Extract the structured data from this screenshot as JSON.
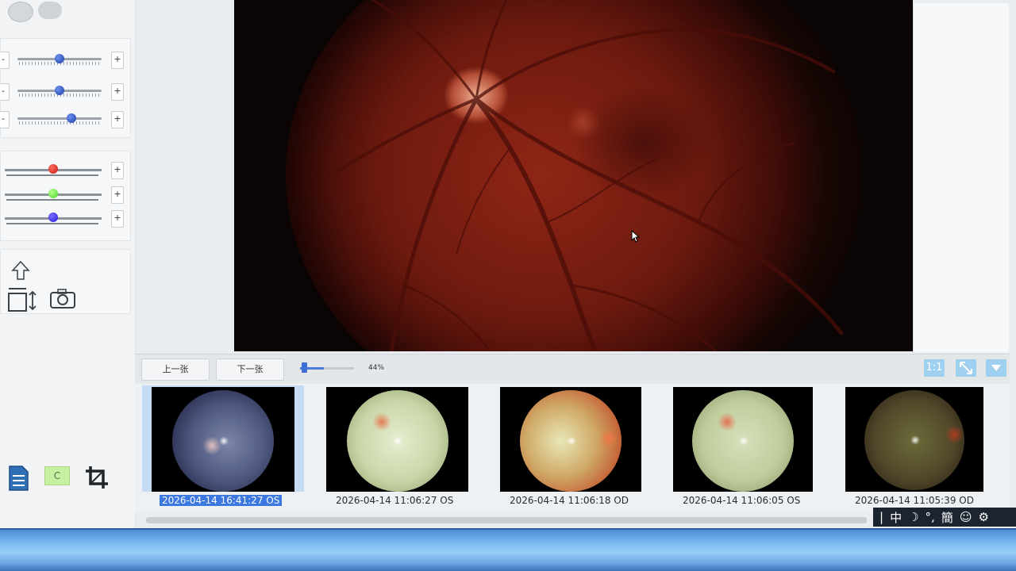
{
  "left_panel": {
    "brightness_sliders": [
      {
        "minus": "-",
        "plus": "+",
        "value": 50
      },
      {
        "minus": "-",
        "plus": "+",
        "value": 50
      },
      {
        "minus": "-",
        "plus": "+",
        "value": 64
      }
    ],
    "color_sliders": [
      {
        "channel": "red",
        "plus": "+",
        "value": 50,
        "color": "#d8261c"
      },
      {
        "channel": "green",
        "plus": "+",
        "value": 50,
        "color": "#6ee64a"
      },
      {
        "channel": "blue",
        "plus": "+",
        "value": 50,
        "color": "#2e24e0"
      }
    ],
    "tools": [
      "arrow-up-icon",
      "fit-height-icon",
      "camera-icon"
    ],
    "bottom_tools": {
      "document_icon": "document-icon",
      "c_label": "C",
      "crop_icon": "crop-icon"
    }
  },
  "viewer": {
    "zoom_percent": "44%",
    "zoom_value": 44
  },
  "nav": {
    "prev_label": "上一张",
    "next_label": "下一张",
    "actual_size_label": "1:1",
    "fit_icon": "fit-arrows-icon",
    "menu_icon": "triangle-down-icon"
  },
  "thumbnails": [
    {
      "caption": "2026-04-14 16:41:27 OS",
      "selected": true
    },
    {
      "caption": "2026-04-14 11:06:27 OS",
      "selected": false
    },
    {
      "caption": "2026-04-14 11:06:18 OD",
      "selected": false
    },
    {
      "caption": "2026-04-14 11:06:05 OS",
      "selected": false
    },
    {
      "caption": "2026-04-14 11:05:39 OD",
      "selected": false
    }
  ],
  "tray": {
    "items": [
      "|",
      "中",
      "☽",
      "°,",
      "簡",
      "☺",
      "⚙"
    ]
  },
  "colors": {
    "accent": "#3b78e0",
    "selection_bg": "#c5daf3"
  }
}
